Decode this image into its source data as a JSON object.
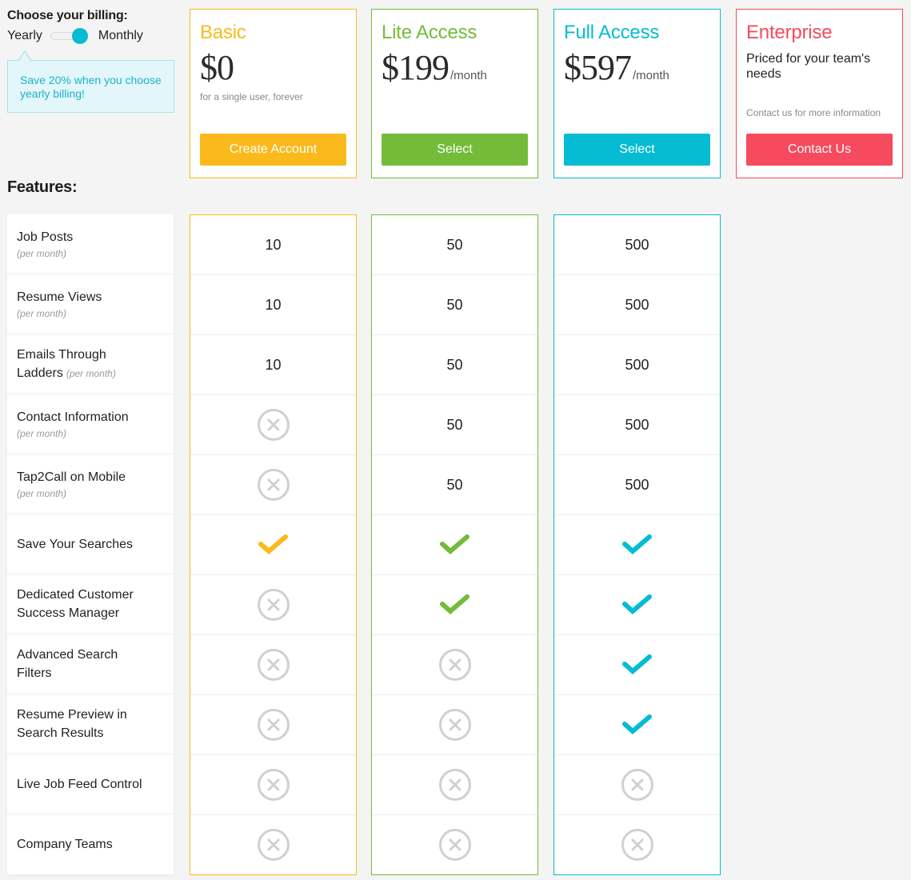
{
  "billing": {
    "title": "Choose your billing:",
    "option_left": "Yearly",
    "option_right": "Monthly",
    "selected": "Monthly",
    "tooltip": "Save 20% when you choose yearly billing!"
  },
  "plans": [
    {
      "name": "Basic",
      "price": "$0",
      "period": "",
      "subtitle": "for a single user, forever",
      "button": "Create Account",
      "color": "#fbb91b"
    },
    {
      "name": "Lite Access",
      "price": "$199",
      "period": "/month",
      "subtitle": "",
      "button": "Select",
      "color": "#73bb39"
    },
    {
      "name": "Full Access",
      "price": "$597",
      "period": "/month",
      "subtitle": "",
      "button": "Select",
      "color": "#05bcd2"
    },
    {
      "name": "Enterprise",
      "description": "Priced for your team's needs",
      "contact_note": "Contact us for more information",
      "button": "Contact Us",
      "color": "#f64a5e"
    }
  ],
  "features_title": "Features:",
  "features": [
    {
      "label": "Job Posts",
      "note": "(per month)",
      "values": [
        "10",
        "50",
        "500"
      ]
    },
    {
      "label": "Resume Views",
      "note": "(per month)",
      "values": [
        "10",
        "50",
        "500"
      ]
    },
    {
      "label": "Emails Through Ladders",
      "note": "(per month)",
      "values": [
        "10",
        "50",
        "500"
      ]
    },
    {
      "label": "Contact Information",
      "note": "(per month)",
      "values": [
        "x",
        "50",
        "500"
      ]
    },
    {
      "label": "Tap2Call on Mobile",
      "note": "(per month)",
      "values": [
        "x",
        "50",
        "500"
      ]
    },
    {
      "label": "Save Your Searches",
      "note": "",
      "values": [
        "check",
        "check",
        "check"
      ]
    },
    {
      "label": "Dedicated Customer Success Manager",
      "note": "",
      "values": [
        "x",
        "check",
        "check"
      ]
    },
    {
      "label": "Advanced Search Filters",
      "note": "",
      "values": [
        "x",
        "x",
        "check"
      ]
    },
    {
      "label": "Resume Preview in Search Results",
      "note": "",
      "values": [
        "x",
        "x",
        "check"
      ]
    },
    {
      "label": "Live Job Feed Control",
      "note": "",
      "values": [
        "x",
        "x",
        "x"
      ]
    },
    {
      "label": "Company Teams",
      "note": "",
      "values": [
        "x",
        "x",
        "x"
      ]
    }
  ],
  "icons": {
    "x": "not-included-icon",
    "check": "included-check-icon"
  },
  "colors": {
    "background": "#f4f4f4",
    "x_icon": "#d0d0d0",
    "tooltip_bg": "#e3f7fa",
    "tooltip_text": "#1ab2c7"
  }
}
